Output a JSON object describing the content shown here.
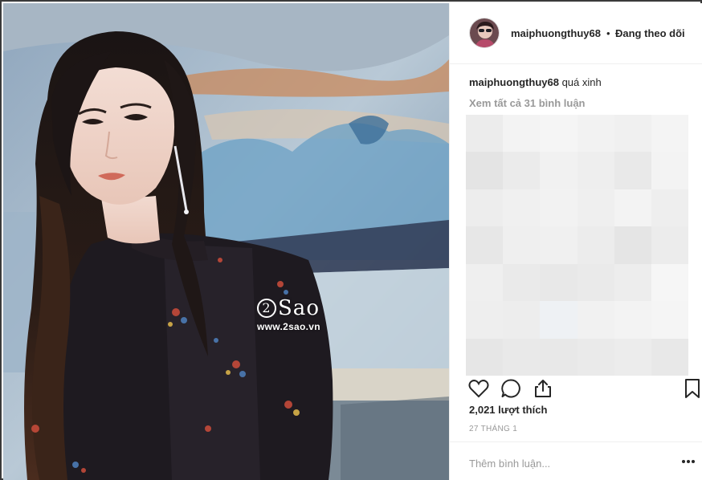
{
  "post": {
    "watermark_logo_text": "Sao",
    "watermark_logo_number": "2",
    "watermark_url": "www.2sao.vn"
  },
  "header": {
    "username": "maiphuongthuy68",
    "separator": "•",
    "follow_status": "Đang theo dõi"
  },
  "caption": {
    "username": "maiphuongthuy68",
    "text": "quá xinh"
  },
  "comments": {
    "view_all": "Xem tất cả 31 bình luận"
  },
  "actions": {
    "like_icon": "heart-icon",
    "comment_icon": "comment-bubble-icon",
    "share_icon": "share-icon",
    "save_icon": "bookmark-icon"
  },
  "likes": "2,021 lượt thích",
  "date": "27 THÁNG 1",
  "comment_input": {
    "placeholder": "Thêm bình luận..."
  },
  "colors": {
    "text": "#262626",
    "muted": "#999999",
    "divider": "#efefef"
  }
}
